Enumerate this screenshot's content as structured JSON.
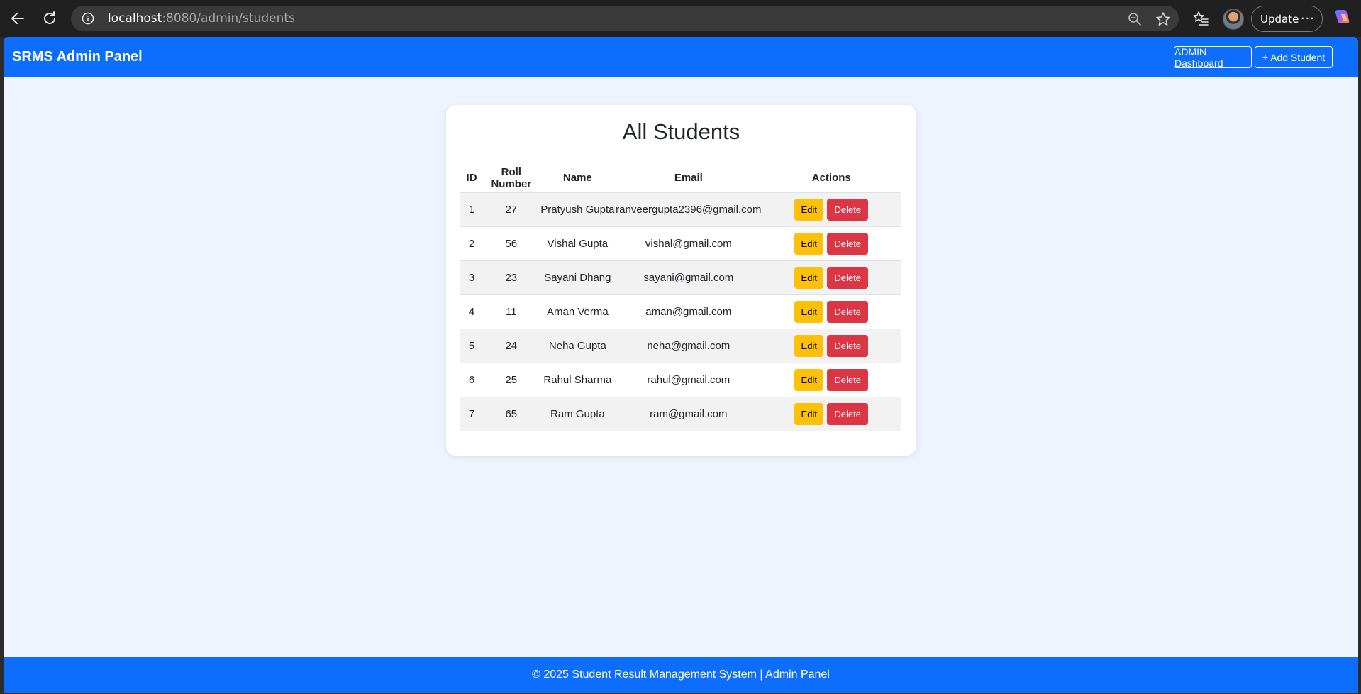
{
  "browser": {
    "url_host": "localhost",
    "url_path": ":8080/admin/students",
    "update_label": "Update",
    "more_label": "···"
  },
  "navbar": {
    "brand": "SRMS Admin Panel",
    "dashboard_label": "ADMIN Dashboard",
    "add_student_label": "+ Add Student"
  },
  "main": {
    "title": "All Students",
    "table": {
      "headers": [
        "ID",
        "Roll Number",
        "Name",
        "Email",
        "Actions"
      ],
      "rows": [
        {
          "id": "1",
          "roll": "27",
          "name": "Pratyush Gupta",
          "email": "ranveergupta2396@gmail.com",
          "edit": "Edit",
          "delete": "Delete"
        },
        {
          "id": "2",
          "roll": "56",
          "name": "Vishal Gupta",
          "email": "vishal@gmail.com",
          "edit": "Edit",
          "delete": "Delete"
        },
        {
          "id": "3",
          "roll": "23",
          "name": "Sayani Dhang",
          "email": "sayani@gmail.com",
          "edit": "Edit",
          "delete": "Delete"
        },
        {
          "id": "4",
          "roll": "11",
          "name": "Aman Verma",
          "email": "aman@gmail.com",
          "edit": "Edit",
          "delete": "Delete"
        },
        {
          "id": "5",
          "roll": "24",
          "name": "Neha Gupta",
          "email": "neha@gmail.com",
          "edit": "Edit",
          "delete": "Delete"
        },
        {
          "id": "6",
          "roll": "25",
          "name": "Rahul Sharma",
          "email": "rahul@gmail.com",
          "edit": "Edit",
          "delete": "Delete"
        },
        {
          "id": "7",
          "roll": "65",
          "name": "Ram Gupta",
          "email": "ram@gmail.com",
          "edit": "Edit",
          "delete": "Delete"
        }
      ]
    }
  },
  "footer": {
    "text": "© 2025 Student Result Management System | Admin Panel"
  },
  "colors": {
    "primary": "#0d6efd",
    "page_bg": "#eef3fd",
    "edit": "#ffc107",
    "delete": "#dc3545"
  }
}
